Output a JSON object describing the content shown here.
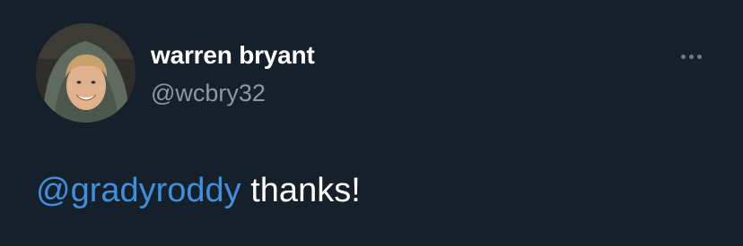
{
  "tweet": {
    "author": {
      "display_name": "warren bryant",
      "handle": "@wcbry32",
      "avatar_icon": "user-avatar-photo"
    },
    "more_icon": "more-horizontal-icon",
    "body": {
      "mention": "@gradyroddy",
      "text": " thanks!"
    }
  },
  "colors": {
    "background": "#15202b",
    "name_text": "#ffffff",
    "handle_text": "#8b98a5",
    "mention_link": "#3f8fdc",
    "more_icon": "#6e7a86"
  }
}
